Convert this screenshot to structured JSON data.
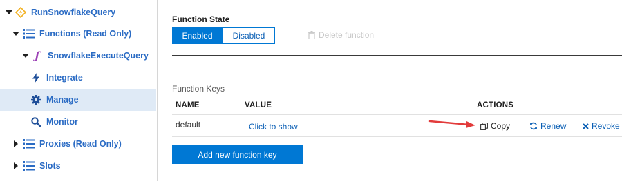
{
  "sidebar": {
    "items": [
      {
        "label": "RunSnowflakeQuery",
        "icon": "function-app-icon"
      },
      {
        "label": "Functions (Read Only)",
        "icon": "list-icon"
      },
      {
        "label": "SnowflakeExecuteQuery",
        "icon": "function-f-icon"
      },
      {
        "label": "Integrate",
        "icon": "lightning-bolt-icon"
      },
      {
        "label": "Manage",
        "icon": "gear-icon",
        "selected": true
      },
      {
        "label": "Monitor",
        "icon": "search-icon"
      },
      {
        "label": "Proxies (Read Only)",
        "icon": "list-icon"
      },
      {
        "label": "Slots",
        "icon": "list-icon"
      }
    ]
  },
  "function_state": {
    "label": "Function State",
    "enabled_label": "Enabled",
    "disabled_label": "Disabled",
    "selected": "Enabled",
    "delete_label": "Delete function"
  },
  "function_keys": {
    "section_label": "Function Keys",
    "columns": [
      "NAME",
      "VALUE",
      "ACTIONS"
    ],
    "rows": [
      {
        "name": "default",
        "value_link": "Click to show",
        "actions": {
          "copy": "Copy",
          "renew": "Renew",
          "revoke": "Revoke"
        }
      }
    ],
    "add_button_label": "Add new function key"
  },
  "colors": {
    "accent": "#0078d4",
    "link": "#0a5fb5",
    "selected_bg": "#dfeaf6",
    "annotation_arrow": "#e23b3b"
  }
}
